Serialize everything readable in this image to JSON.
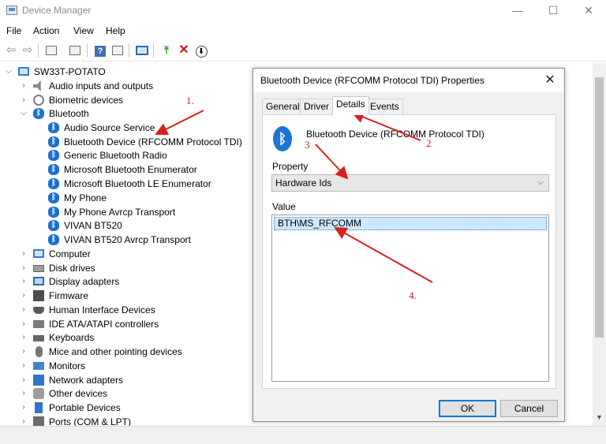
{
  "window": {
    "title": "Device Manager",
    "controls": {
      "minimize": "—",
      "maximize": "☐",
      "close": "✕"
    }
  },
  "menu": [
    "File",
    "Action",
    "View",
    "Help"
  ],
  "toolbar": {
    "back": "⇦",
    "forward": "⇨",
    "help": "?",
    "uninstall": "✕",
    "download": "⬇",
    "enable": "⤒"
  },
  "tree": {
    "root": "SW33T-POTATO",
    "categories": [
      {
        "label": "Audio inputs and outputs",
        "icon": "speaker-icon",
        "expanded": false
      },
      {
        "label": "Biometric devices",
        "icon": "fingerprint-icon",
        "expanded": false
      },
      {
        "label": "Bluetooth",
        "icon": "bluetooth-icon",
        "expanded": true
      },
      {
        "label": "Computer",
        "icon": "computer-icon",
        "expanded": false
      },
      {
        "label": "Disk drives",
        "icon": "disk-icon",
        "expanded": false
      },
      {
        "label": "Display adapters",
        "icon": "display-icon",
        "expanded": false
      },
      {
        "label": "Firmware",
        "icon": "chip-icon",
        "expanded": false
      },
      {
        "label": "Human Interface Devices",
        "icon": "hid-icon",
        "expanded": false
      },
      {
        "label": "IDE ATA/ATAPI controllers",
        "icon": "ide-icon",
        "expanded": false
      },
      {
        "label": "Keyboards",
        "icon": "keyboard-icon",
        "expanded": false
      },
      {
        "label": "Mice and other pointing devices",
        "icon": "mouse-icon",
        "expanded": false
      },
      {
        "label": "Monitors",
        "icon": "monitor-icon",
        "expanded": false
      },
      {
        "label": "Network adapters",
        "icon": "network-icon",
        "expanded": false
      },
      {
        "label": "Other devices",
        "icon": "other-devices-icon",
        "expanded": false
      },
      {
        "label": "Portable Devices",
        "icon": "portable-icon",
        "expanded": false
      },
      {
        "label": "Ports (COM & LPT)",
        "icon": "ports-icon",
        "expanded": false
      }
    ],
    "bluetooth_children": [
      "Audio Source Service",
      "Bluetooth Device (RFCOMM Protocol TDI)",
      "Generic Bluetooth Radio",
      "Microsoft Bluetooth Enumerator",
      "Microsoft Bluetooth LE Enumerator",
      "My Phone",
      "My Phone Avrcp Transport",
      "VIVAN BT520",
      "VIVAN BT520 Avrcp Transport"
    ]
  },
  "dialog": {
    "title": "Bluetooth Device (RFCOMM Protocol TDI) Properties",
    "close": "✕",
    "tabs": [
      "General",
      "Driver",
      "Details",
      "Events"
    ],
    "active_tab": "Details",
    "device_name": "Bluetooth Device (RFCOMM Protocol TDI)",
    "bt_glyph": "ᛒ",
    "property_label": "Property",
    "property_value": "Hardware Ids",
    "dropdown_arrow": "⌵",
    "value_label": "Value",
    "value_items": [
      "BTH\\MS_RFCOMM"
    ],
    "ok_label": "OK",
    "cancel_label": "Cancel"
  },
  "annotations": [
    "1.",
    "2",
    "3",
    "4."
  ],
  "colors": {
    "accent": "#0078d7",
    "annotation": "#d42020",
    "bluetooth": "#1a6fd1"
  }
}
